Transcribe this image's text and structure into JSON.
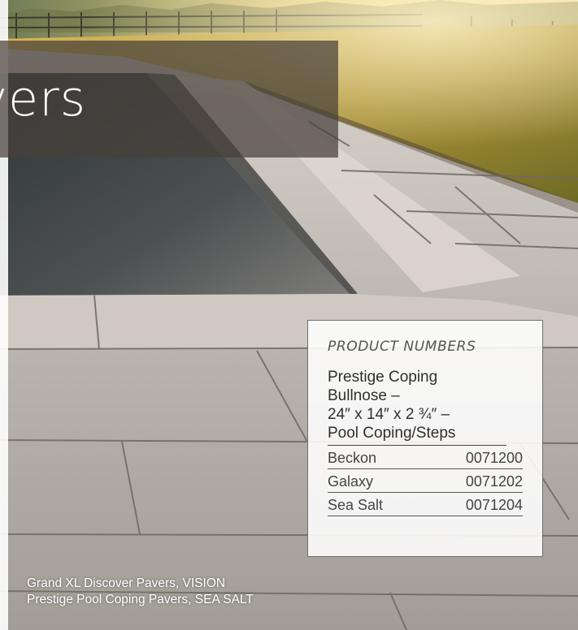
{
  "banner": {
    "title_fragment": "vers"
  },
  "product_card": {
    "heading": "PRODUCT NUMBERS",
    "product_lines": [
      "Prestige Coping",
      "Bullnose –",
      "24″ x 14″ x 2 ¾″ –",
      "Pool Coping/Steps"
    ],
    "colors": [
      {
        "name": "Beckon",
        "number": "0071200"
      },
      {
        "name": "Galaxy",
        "number": "0071202"
      },
      {
        "name": "Sea Salt",
        "number": "0071204"
      }
    ]
  },
  "caption": {
    "line1": "Grand XL Discover Pavers, VISION",
    "line2": "Prestige Pool Coping Pavers, SEA SALT"
  },
  "palette": {
    "paver": "#b8b2ad",
    "water": "#4c4d4e",
    "grass": "#b79a3c",
    "sky": "#e7c97a"
  }
}
